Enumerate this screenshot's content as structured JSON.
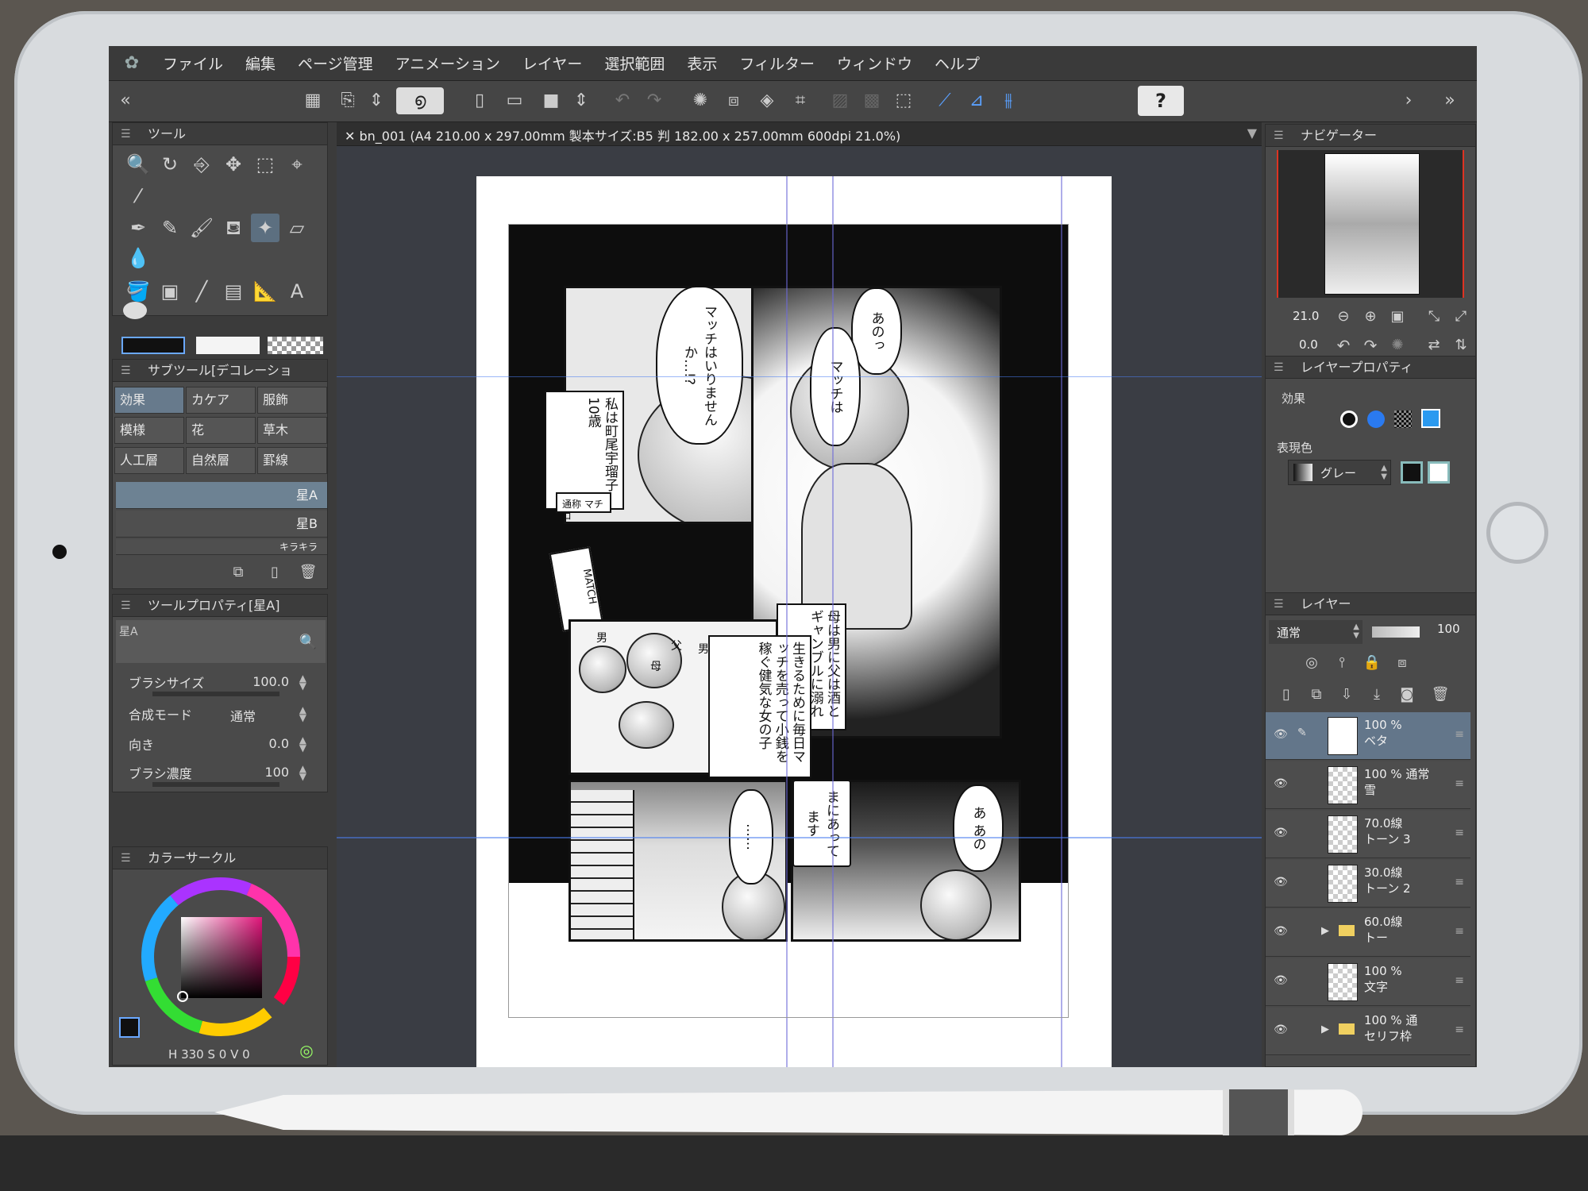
{
  "menu": {
    "items": [
      "ファイル",
      "編集",
      "ページ管理",
      "アニメーション",
      "レイヤー",
      "選択範囲",
      "表示",
      "フィルター",
      "ウィンドウ",
      "ヘルプ"
    ]
  },
  "command_bar": {
    "help_label": "?"
  },
  "document": {
    "tab_label": "bn_001 (A4 210.00 x 297.00mm 製本サイズ:B5 判 182.00 x 257.00mm 600dpi 21.0%)"
  },
  "tool_panel": {
    "title": "ツール"
  },
  "subtool_panel": {
    "title": "サブツール[デコレーショ",
    "categories": [
      "効果",
      "カケア",
      "服飾",
      "模様",
      "花",
      "草木",
      "人工層",
      "自然層",
      "罫線"
    ],
    "brushes": [
      "星A",
      "星B",
      "キラキラ"
    ]
  },
  "tool_property": {
    "title": "ツールプロパティ[星A]",
    "preview_label": "星A",
    "rows": [
      {
        "label": "ブラシサイズ",
        "value": "100.0"
      },
      {
        "label": "合成モード",
        "value": "通常"
      },
      {
        "label": "向き",
        "value": "0.0"
      },
      {
        "label": "ブラシ濃度",
        "value": "100"
      }
    ]
  },
  "color_panel": {
    "title": "カラーサークル",
    "readout": {
      "h_label": "H",
      "h": "330",
      "s_label": "S",
      "s": "0",
      "v_label": "V",
      "v": "0"
    }
  },
  "navigator": {
    "title": "ナビゲーター",
    "zoom": "21.0",
    "rotation": "0.0"
  },
  "layer_property": {
    "title": "レイヤープロパティ",
    "effect_label": "効果",
    "color_label": "表現色",
    "color_value": "グレー"
  },
  "layers": {
    "title": "レイヤー",
    "blend_mode": "通常",
    "opacity": "100",
    "rows": [
      {
        "line1": "100 %",
        "line2": "ベタ"
      },
      {
        "line1": "100 % 通常",
        "line2": "雪"
      },
      {
        "line1": "70.0線",
        "line2": "トーン 3"
      },
      {
        "line1": "30.0線",
        "line2": "トーン 2"
      },
      {
        "line1": "60.0線",
        "line2": "トー"
      },
      {
        "line1": "100 %",
        "line2": "文字"
      },
      {
        "line1": "100 % 通",
        "line2": "セリフ枠"
      }
    ]
  },
  "manga": {
    "bubble_ano": "あのっ",
    "bubble_match_big": "マッチはいりませんか…!?",
    "bubble_match_small": "マッチは",
    "caption_intro": "私は町尾宇瑠子10歳",
    "caption_credit": "通称 マチコ",
    "box_label": "MATCH",
    "caption_parents": "母は男に父は酒とギャンブルに溺れ",
    "caption_life": "生きるために毎日マッチを売って小銭を稼ぐ健気な女の子",
    "sign_father": "父",
    "sign_mother": "母",
    "sign_man": "男",
    "bubble_dots": "……",
    "bubble_mani": "まにあってます",
    "bubble_a": "あ あの"
  },
  "colors": {
    "ui_dark": "#3b3b3b",
    "selection_blue": "#63768a",
    "guide_purple": "#6d6ad8",
    "fg_color": "#101010"
  }
}
